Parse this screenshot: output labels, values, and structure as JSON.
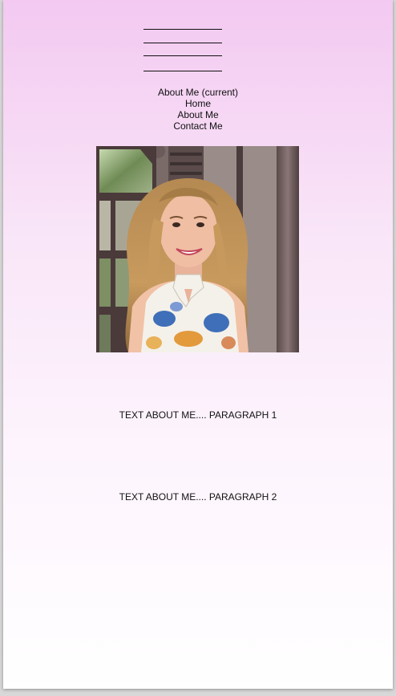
{
  "nav": {
    "items": [
      {
        "label": "About Me (current)"
      },
      {
        "label": "Home"
      },
      {
        "label": "About Me"
      },
      {
        "label": "Contact Me"
      }
    ]
  },
  "content": {
    "paragraph_1": "TEXT ABOUT ME.... PARAGRAPH 1",
    "paragraph_2": "TEXT ABOUT ME.... PARAGRAPH 2"
  },
  "colors": {
    "gradient_top": "#f3c9f1",
    "gradient_bottom": "#ffffff",
    "text": "#111111"
  }
}
